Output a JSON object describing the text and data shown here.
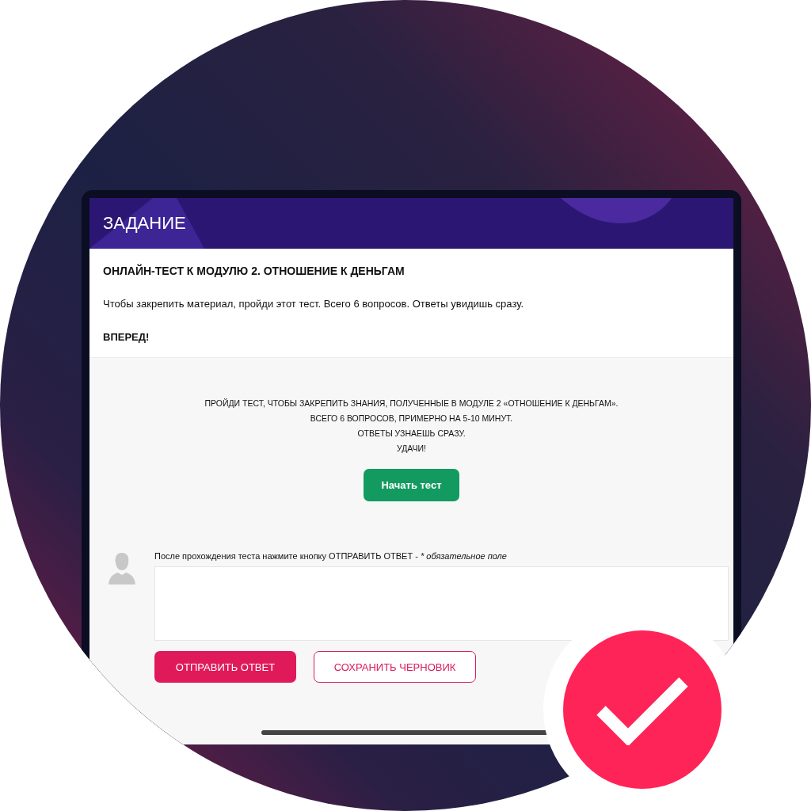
{
  "header": {
    "title": "ЗАДАНИЕ"
  },
  "task": {
    "title": "ОНЛАЙН-ТЕСТ К МОДУЛЮ 2. ОТНОШЕНИЕ К ДЕНЬГАМ",
    "description": "Чтобы закрепить материал, пройди этот тест. Всего 6 вопросов. Ответы увидишь сразу.",
    "cta": "ВПЕРЕД!"
  },
  "intro_lines": [
    "ПРОЙДИ ТЕСТ, ЧТОБЫ ЗАКРЕПИТЬ ЗНАНИЯ, ПОЛУЧЕННЫЕ В МОДУЛЕ 2 «ОТНОШЕНИЕ К ДЕНЬГАМ».",
    "ВСЕГО 6 ВОПРОСОВ, ПРИМЕРНО НА 5-10 МИНУТ.",
    "ОТВЕТЫ УЗНАЕШЬ СРАЗУ.",
    "УДАЧИ!"
  ],
  "start_button": "Начать тест",
  "answer": {
    "label": "После прохождения теста нажмите кнопку ОТПРАВИТЬ ОТВЕТ -",
    "required_note": "* обязательное поле"
  },
  "buttons": [
    {
      "kind": "primary",
      "label": "ОТПРАВИТЬ ОТВЕТ"
    },
    {
      "kind": "outline",
      "label": "СОХРАНИТЬ ЧЕРНОВИК"
    }
  ]
}
